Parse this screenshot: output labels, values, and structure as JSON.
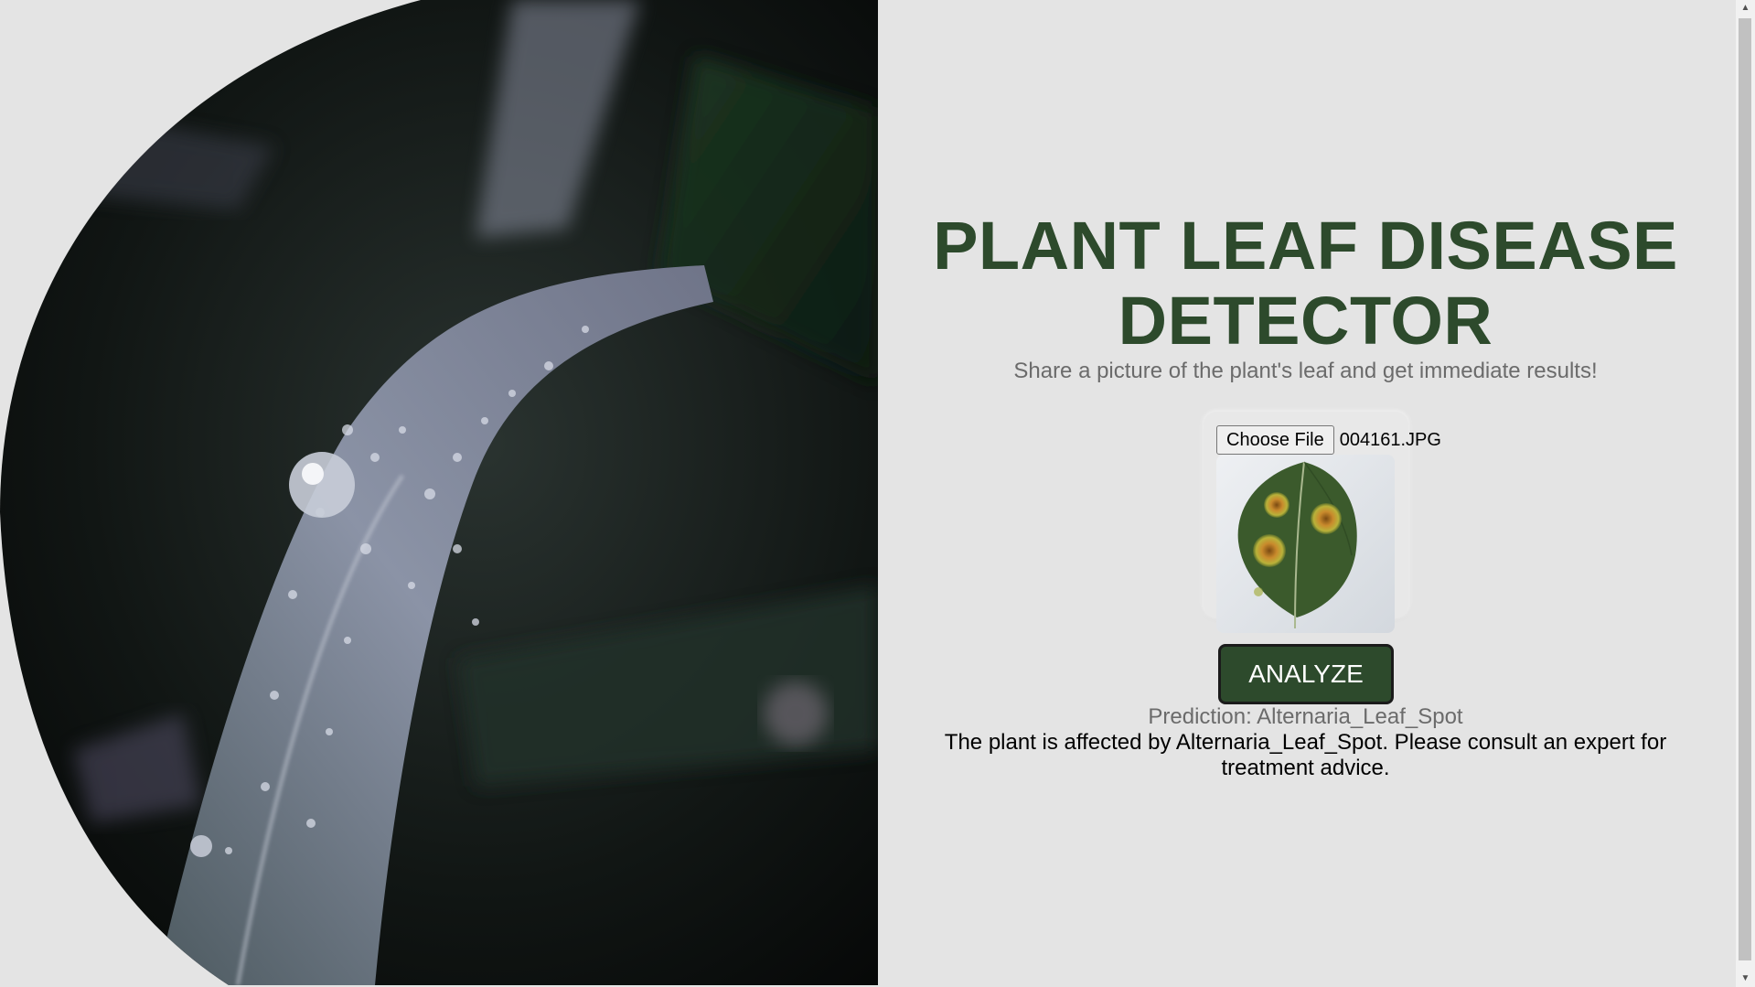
{
  "hero": {
    "image_description_icon": "dewy-grass-blade-photo"
  },
  "header": {
    "title": "PLANT LEAF DISEASE DETECTOR",
    "subtitle": "Share a picture of the plant's leaf and get immediate results!"
  },
  "upload": {
    "choose_label": "Choose File",
    "file_name": "004161.JPG",
    "preview_icon": "leaf-preview-image"
  },
  "actions": {
    "analyze_label": "ANALYZE"
  },
  "result": {
    "prediction": "Prediction: Alternaria_Leaf_Spot",
    "advice": "The plant is affected by Alternaria_Leaf_Spot. Please consult an expert for treatment advice."
  },
  "colors": {
    "background": "#e4e4e4",
    "accent": "#2d4a2c",
    "muted_text": "#6b6b6b"
  }
}
